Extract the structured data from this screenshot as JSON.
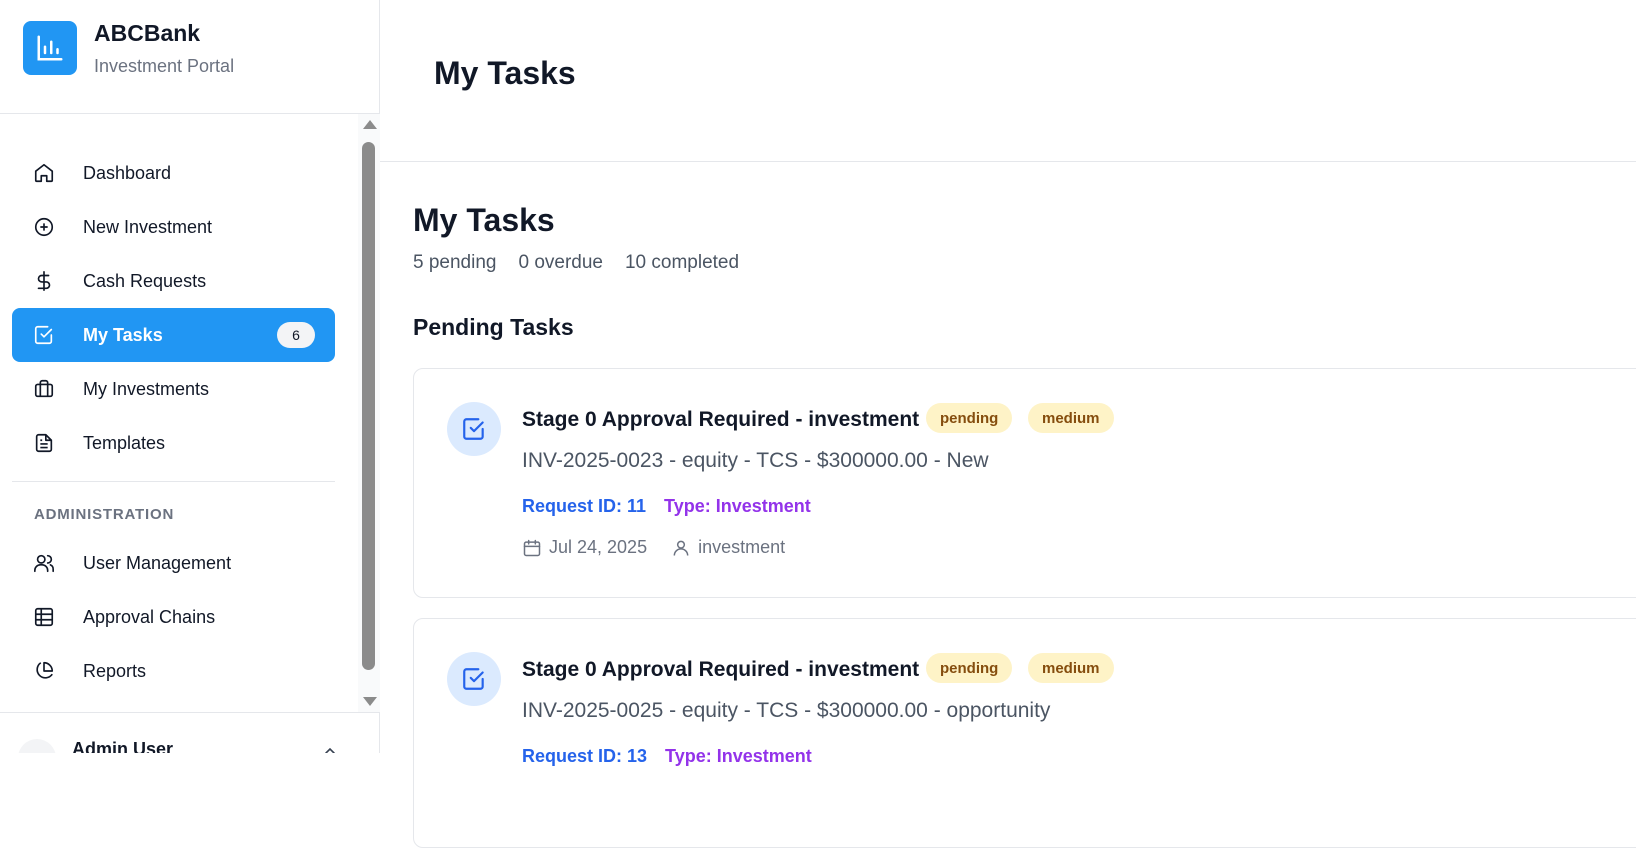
{
  "brand": {
    "name": "ABCBank",
    "subtitle": "Investment Portal"
  },
  "nav": {
    "items": [
      {
        "label": "Dashboard",
        "icon": "home-icon"
      },
      {
        "label": "New Investment",
        "icon": "plus-circle-icon"
      },
      {
        "label": "Cash Requests",
        "icon": "dollar-icon"
      },
      {
        "label": "My Tasks",
        "icon": "check-square-icon",
        "badge": "6",
        "active": true
      },
      {
        "label": "My Investments",
        "icon": "briefcase-icon"
      },
      {
        "label": "Templates",
        "icon": "document-icon"
      }
    ],
    "admin_section_label": "ADMINISTRATION",
    "admin_items": [
      {
        "label": "User Management",
        "icon": "users-icon"
      },
      {
        "label": "Approval Chains",
        "icon": "table-icon"
      },
      {
        "label": "Reports",
        "icon": "pie-chart-icon"
      }
    ]
  },
  "user": {
    "name": "Admin User"
  },
  "header": {
    "title": "My Tasks"
  },
  "main": {
    "title": "My Tasks",
    "stats": {
      "pending": "5 pending",
      "overdue": "0 overdue",
      "completed": "10 completed"
    },
    "section_title": "Pending Tasks",
    "tasks": [
      {
        "title": "Stage 0 Approval Required - investment",
        "status": "pending",
        "priority": "medium",
        "description": "INV-2025-0023 - equity - TCS - $300000.00 - New",
        "request_id": "Request ID: 11",
        "type": "Type: Investment",
        "date": "Jul 24, 2025",
        "assignee": "investment"
      },
      {
        "title": "Stage 0 Approval Required - investment",
        "status": "pending",
        "priority": "medium",
        "description": "INV-2025-0025 - equity - TCS - $300000.00 - opportunity",
        "request_id": "Request ID: 13",
        "type": "Type: Investment",
        "date": "",
        "assignee": ""
      }
    ]
  },
  "colors": {
    "primary": "#2196f3",
    "badge_bg": "#fef3c7",
    "badge_text": "#854d0e",
    "request_id": "#2563eb",
    "type": "#9333ea"
  }
}
